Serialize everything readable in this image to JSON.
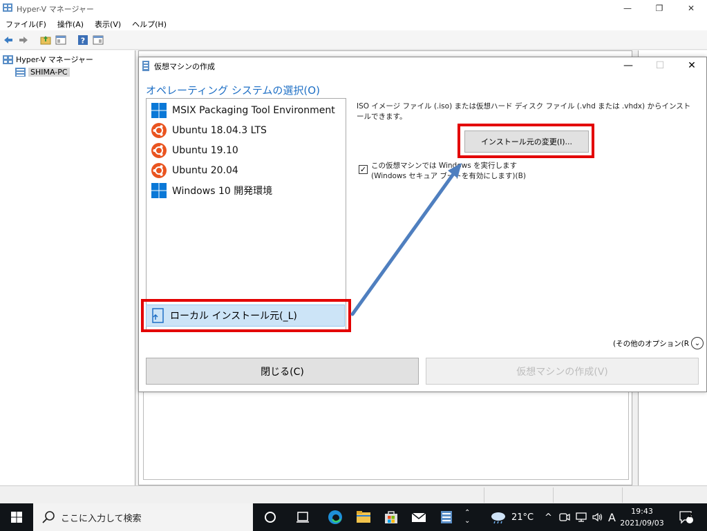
{
  "window": {
    "title": "Hyper-V マネージャー",
    "minimize_glyph": "—",
    "restore_glyph": "❐",
    "close_glyph": "✕"
  },
  "menu": [
    "ファイル(F)",
    "操作(A)",
    "表示(V)",
    "ヘルプ(H)"
  ],
  "tree": {
    "root": "Hyper-V マネージャー",
    "child": "SHIMA-PC"
  },
  "dialog": {
    "title": "仮想マシンの作成",
    "heading": "オペレーティング システムの選択(O)",
    "os_items": [
      {
        "label": "MSIX Packaging Tool Environment",
        "icon": "windows-icon"
      },
      {
        "label": "Ubuntu 18.04.3 LTS",
        "icon": "ubuntu-icon"
      },
      {
        "label": "Ubuntu 19.10",
        "icon": "ubuntu-icon"
      },
      {
        "label": "Ubuntu 20.04",
        "icon": "ubuntu-icon"
      },
      {
        "label": "Windows 10 開発環境",
        "icon": "windows-icon"
      }
    ],
    "local_install": "ローカル インストール元(_L)",
    "iso_description": "ISO イメージ ファイル (.iso) または仮想ハード ディスク ファイル (.vhd または .vhdx) からインストールできます。",
    "change_source_button": "インストール元の変更(I)...",
    "windows_checkbox_line1": "この仮想マシンでは Windows を実行します",
    "windows_checkbox_line2": "(Windows セキュア ブートを有効にします)(B)",
    "windows_checkbox_checked": true,
    "more_options": "(その他のオプション(R",
    "close_button": "閉じる(C)",
    "create_button": "仮想マシンの作成(V)"
  },
  "taskbar": {
    "search_placeholder": "ここに入力して検索",
    "weather": "21°C",
    "ime": "A",
    "time": "19:43",
    "date": "2021/09/03",
    "notification_count": "2"
  },
  "colors": {
    "highlight_red": "#e30000",
    "arrow_blue": "#4f7fbf",
    "heading_blue": "#1e6fc5",
    "ubuntu_orange": "#e95420",
    "windows_blue": "#0a78d7"
  }
}
